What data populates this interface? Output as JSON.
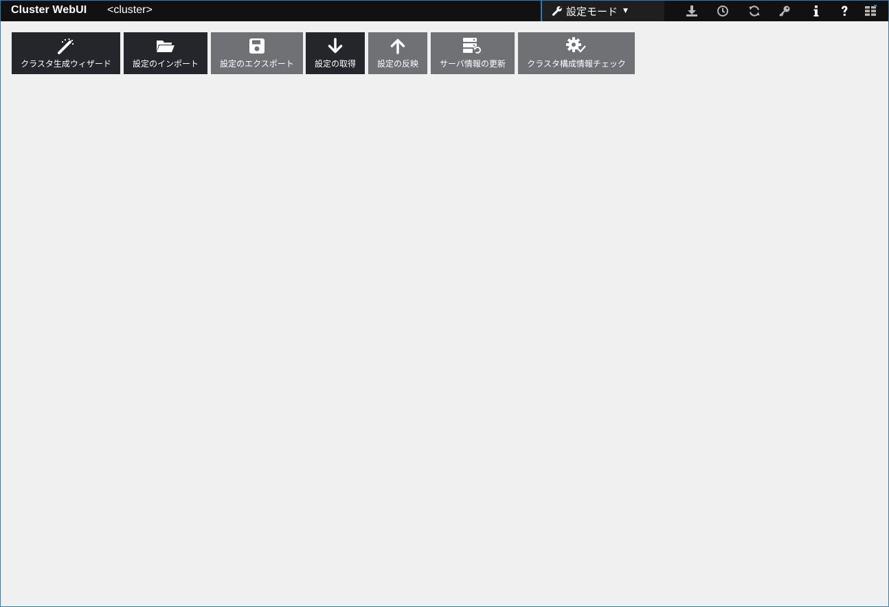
{
  "header": {
    "brand": "Cluster WebUI",
    "cluster_name": "<cluster>",
    "mode_label": "設定モード",
    "icons": [
      "download-icon",
      "clock-icon",
      "refresh-icon",
      "key-icon",
      "info-icon",
      "help-icon",
      "grid-icon"
    ]
  },
  "toolbar": {
    "buttons": [
      {
        "label": "クラスタ生成ウィザード",
        "icon": "magic-wand-icon",
        "style": "dark"
      },
      {
        "label": "設定のインポート",
        "icon": "folder-open-icon",
        "style": "dark"
      },
      {
        "label": "設定のエクスポート",
        "icon": "save-icon",
        "style": "gray"
      },
      {
        "label": "設定の取得",
        "icon": "arrow-down-icon",
        "style": "dark"
      },
      {
        "label": "設定の反映",
        "icon": "arrow-up-icon",
        "style": "gray"
      },
      {
        "label": "サーバ情報の更新",
        "icon": "server-refresh-icon",
        "style": "gray"
      },
      {
        "label": "クラスタ構成情報チェック",
        "icon": "gear-check-icon",
        "style": "gray"
      }
    ]
  },
  "colors": {
    "topbar": "#111111",
    "accent": "#2b7fb8",
    "button_dark": "#24262b",
    "button_gray": "#707175",
    "background": "#f0f0f0"
  }
}
